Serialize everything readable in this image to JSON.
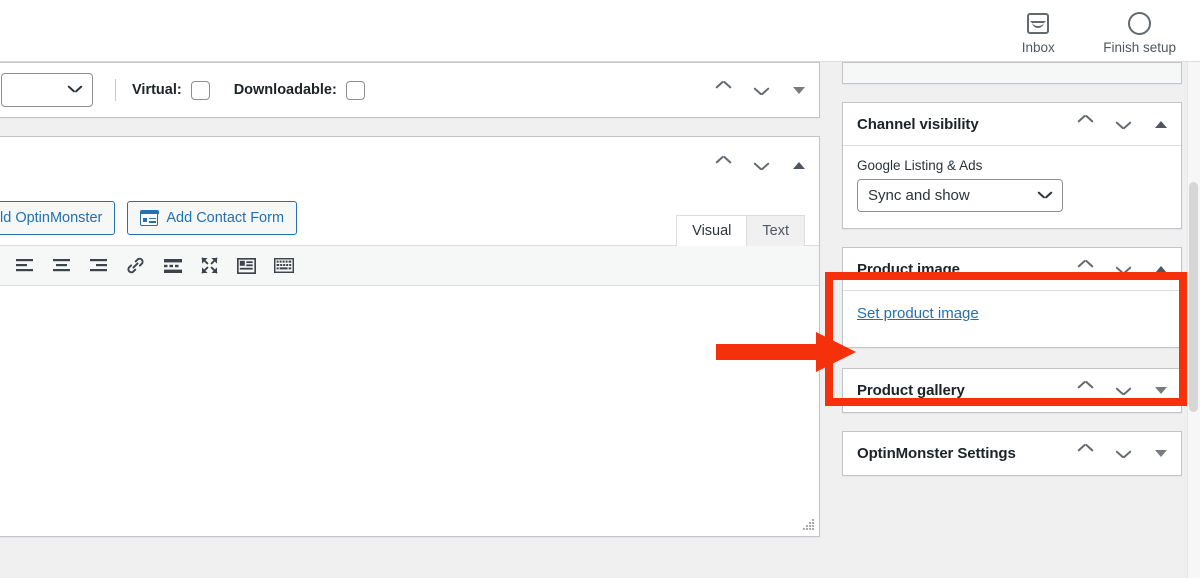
{
  "topbar": {
    "items": [
      {
        "label": "Inbox",
        "icon": "inbox-icon"
      },
      {
        "label": "Finish setup",
        "icon": "circle-progress-icon"
      }
    ]
  },
  "product_data_panel": {
    "product_type_value": "",
    "checkboxes": [
      {
        "label": "Virtual:",
        "checked": false
      },
      {
        "label": "Downloadable:",
        "checked": false
      }
    ],
    "order_controls": {
      "move_up": "∧",
      "move_down": "∨",
      "toggle": "▼"
    }
  },
  "editor_panel": {
    "order_controls": {
      "move_up": "∧",
      "move_down": "∨",
      "toggle": "▲"
    },
    "media_buttons": [
      {
        "label": "ld OptinMonster",
        "icon": "optinmonster-icon",
        "truncated": true
      },
      {
        "label": "Add Contact Form",
        "icon": "contact-form-icon",
        "truncated": false
      }
    ],
    "tabs": [
      {
        "label": "Visual",
        "active": true
      },
      {
        "label": "Text",
        "active": false
      }
    ],
    "toolbar_icons": [
      "bullet-list-icon",
      "align-left-icon",
      "align-center-icon",
      "align-right-icon",
      "insert-link-icon",
      "insert-read-more-icon",
      "fullscreen-icon",
      "toolbar-toggle-icon",
      "keyboard-shortcuts-icon"
    ],
    "content": "",
    "resize_handle": "resize-grip-icon"
  },
  "sidebar": {
    "panels": [
      {
        "id": "channel-visibility",
        "title": "Channel visibility",
        "collapsed": false,
        "toggle_icon": "▲",
        "field_label": "Google Listing & Ads",
        "select_value": "Sync and show"
      },
      {
        "id": "product-image",
        "title": "Product image",
        "collapsed": false,
        "toggle_icon": "▲",
        "link_label": "Set product image",
        "highlighted": true
      },
      {
        "id": "product-gallery",
        "title": "Product gallery",
        "collapsed": true,
        "toggle_icon": "▼"
      },
      {
        "id": "optinmonster-settings",
        "title": "OptinMonster Settings",
        "collapsed": true,
        "toggle_icon": "▼"
      }
    ]
  },
  "annotations": {
    "arrow_color": "#f5310b",
    "box_color": "#f5310b",
    "points_to": "Set product image"
  },
  "colors": {
    "link": "#2271b1",
    "text": "#1d2327",
    "muted": "#50575e",
    "panel_border": "#c3c4c7",
    "page_bg": "#f0f0f1",
    "accent_red": "#f5310b"
  }
}
